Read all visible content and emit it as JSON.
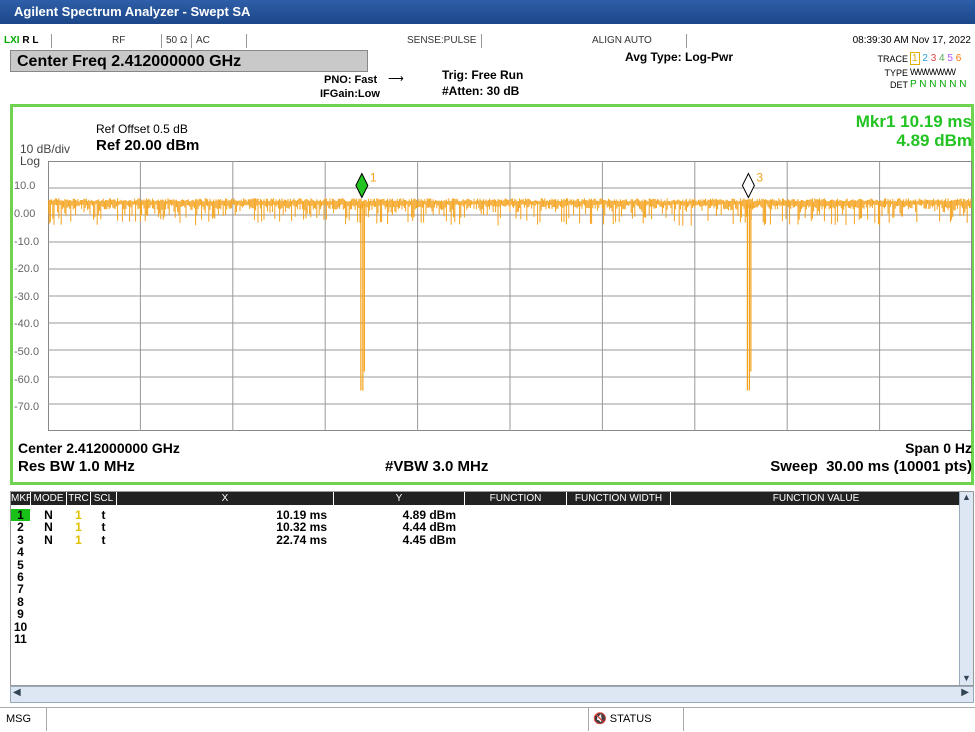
{
  "window": {
    "title": "Agilent Spectrum Analyzer - Swept SA"
  },
  "topbar": {
    "logo": "LXI",
    "rl": "R L",
    "rf": "RF",
    "impedance": "50 Ω",
    "coupling": "AC",
    "sense": "SENSE:PULSE",
    "align": "ALIGN AUTO",
    "datetime": "08:39:30 AM Nov 17, 2022"
  },
  "header": {
    "center_freq": "Center Freq 2.412000000 GHz",
    "pno": "PNO: Fast",
    "ifgain": "IFGain:Low",
    "trig": "Trig: Free Run",
    "atten": "#Atten: 30 dB",
    "avg_type": "Avg Type: Log-Pwr",
    "trace_label": "TRACE",
    "trace_digits": [
      "1",
      "2",
      "3",
      "4",
      "5",
      "6"
    ],
    "type_label": "TYPE",
    "type_value": "WWWWWW",
    "det_label": "DET",
    "det_value": "P N N N N N"
  },
  "display": {
    "scale_top": "10 dB/div",
    "scale_bot": "Log",
    "ref_offset": "Ref Offset 0.5 dB",
    "ref_level": "Ref 20.00 dBm",
    "marker_readout_1": "Mkr1 10.19 ms",
    "marker_readout_2": "4.89 dBm",
    "y_ticks": [
      "10.0",
      "0.00",
      "-10.0",
      "-20.0",
      "-30.0",
      "-40.0",
      "-50.0",
      "-60.0",
      "-70.0"
    ],
    "center_label": "Center 2.412000000 GHz",
    "span_label": "Span 0 Hz",
    "rbw_label": "Res BW 1.0 MHz",
    "vbw_label": "#VBW 3.0 MHz",
    "sweep_label": "Sweep  30.00 ms (10001 pts)",
    "markers": [
      {
        "label": "1",
        "x_ms": 10.19
      },
      {
        "label": "3",
        "x_ms": 22.74
      }
    ],
    "trace_color": "#f4a21a",
    "marker_color": "#f4a21a",
    "active_marker_color": "#22c322"
  },
  "marker_table": {
    "headers": [
      "MKR",
      "MODE",
      "TRC",
      "SCL",
      "X",
      "Y",
      "FUNCTION",
      "FUNCTION WIDTH",
      "FUNCTION VALUE"
    ],
    "rows": [
      {
        "mkr": "1",
        "mode": "N",
        "trc": "1",
        "scl": "t",
        "x": "10.19 ms",
        "y": "4.89 dBm"
      },
      {
        "mkr": "2",
        "mode": "N",
        "trc": "1",
        "scl": "t",
        "x": "10.32 ms",
        "y": "4.44 dBm"
      },
      {
        "mkr": "3",
        "mode": "N",
        "trc": "1",
        "scl": "t",
        "x": "22.74 ms",
        "y": "4.45 dBm"
      },
      {
        "mkr": "4"
      },
      {
        "mkr": "5"
      },
      {
        "mkr": "6"
      },
      {
        "mkr": "7"
      },
      {
        "mkr": "8"
      },
      {
        "mkr": "9"
      },
      {
        "mkr": "10"
      },
      {
        "mkr": "11"
      }
    ]
  },
  "bottom": {
    "msg": "MSG",
    "status": "STATUS"
  }
}
